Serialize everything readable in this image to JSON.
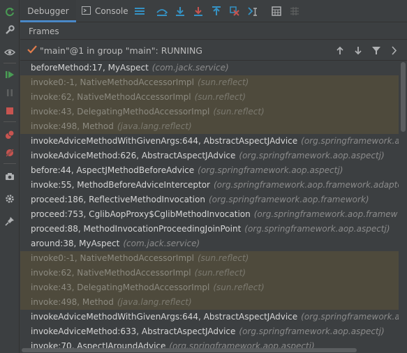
{
  "tabs": {
    "debugger": "Debugger",
    "console": "Console"
  },
  "frames_header": "Frames",
  "thread": {
    "label": "\"main\"@1 in group \"main\": RUNNING"
  },
  "frames": [
    {
      "method": "beforeMethod:17, MyAspect",
      "package": "(com.jack.service)",
      "library": false
    },
    {
      "method": "invoke0:-1, NativeMethodAccessorImpl",
      "package": "(sun.reflect)",
      "library": true
    },
    {
      "method": "invoke:62, NativeMethodAccessorImpl",
      "package": "(sun.reflect)",
      "library": true
    },
    {
      "method": "invoke:43, DelegatingMethodAccessorImpl",
      "package": "(sun.reflect)",
      "library": true
    },
    {
      "method": "invoke:498, Method",
      "package": "(java.lang.reflect)",
      "library": true
    },
    {
      "method": "invokeAdviceMethodWithGivenArgs:644, AbstractAspectJAdvice",
      "package": "(org.springframework.aop.asp",
      "library": false
    },
    {
      "method": "invokeAdviceMethod:626, AbstractAspectJAdvice",
      "package": "(org.springframework.aop.aspectj)",
      "library": false
    },
    {
      "method": "before:44, AspectJMethodBeforeAdvice",
      "package": "(org.springframework.aop.aspectj)",
      "library": false
    },
    {
      "method": "invoke:55, MethodBeforeAdviceInterceptor",
      "package": "(org.springframework.aop.framework.adapter)",
      "library": false
    },
    {
      "method": "proceed:186, ReflectiveMethodInvocation",
      "package": "(org.springframework.aop.framework)",
      "library": false
    },
    {
      "method": "proceed:753, CglibAopProxy$CglibMethodInvocation",
      "package": "(org.springframework.aop.framew",
      "library": false
    },
    {
      "method": "proceed:88, MethodInvocationProceedingJoinPoint",
      "package": "(org.springframework.aop.aspectj)",
      "library": false
    },
    {
      "method": "around:38, MyAspect",
      "package": "(com.jack.service)",
      "library": false
    },
    {
      "method": "invoke0:-1, NativeMethodAccessorImpl",
      "package": "(sun.reflect)",
      "library": true
    },
    {
      "method": "invoke:62, NativeMethodAccessorImpl",
      "package": "(sun.reflect)",
      "library": true
    },
    {
      "method": "invoke:43, DelegatingMethodAccessorImpl",
      "package": "(sun.reflect)",
      "library": true
    },
    {
      "method": "invoke:498, Method",
      "package": "(java.lang.reflect)",
      "library": true
    },
    {
      "method": "invokeAdviceMethodWithGivenArgs:644, AbstractAspectJAdvice",
      "package": "(org.springframework.aop.asp",
      "library": false
    },
    {
      "method": "invokeAdviceMethod:633, AbstractAspectJAdvice",
      "package": "(org.springframework.aop.aspectj)",
      "library": false
    },
    {
      "method": "invoke:70, AspectJAroundAdvice",
      "package": "(org.springframework.aop.aspectj)",
      "library": false
    }
  ],
  "icons": {
    "left_toolbar": [
      "rerun-icon",
      "settings-wrench-icon",
      "watch-eye-icon",
      "resume-icon",
      "pause-icon",
      "stop-icon",
      "view-breakpoints-icon",
      "mute-breakpoints-icon",
      "camera-icon",
      "settings-gear-icon",
      "pin-icon"
    ],
    "top_toolbar": [
      "console-icon",
      "layout-menu-icon",
      "show-execution-point-icon",
      "step-over-icon",
      "step-into-icon",
      "force-step-into-icon",
      "step-out-icon",
      "drop-frame-icon",
      "run-to-cursor-icon",
      "evaluate-expression-icon",
      "trace-icon"
    ],
    "thread_controls": [
      "previous-frame-icon",
      "next-frame-icon",
      "filter-icon",
      "more-icon"
    ]
  },
  "colors": {
    "background": "#3c3f41",
    "library_frame": "#4e4a3c",
    "accent_blue": "#3592c4",
    "stop_red": "#c75450",
    "resume_green": "#499c54",
    "check_orange": "#e07c4c"
  }
}
